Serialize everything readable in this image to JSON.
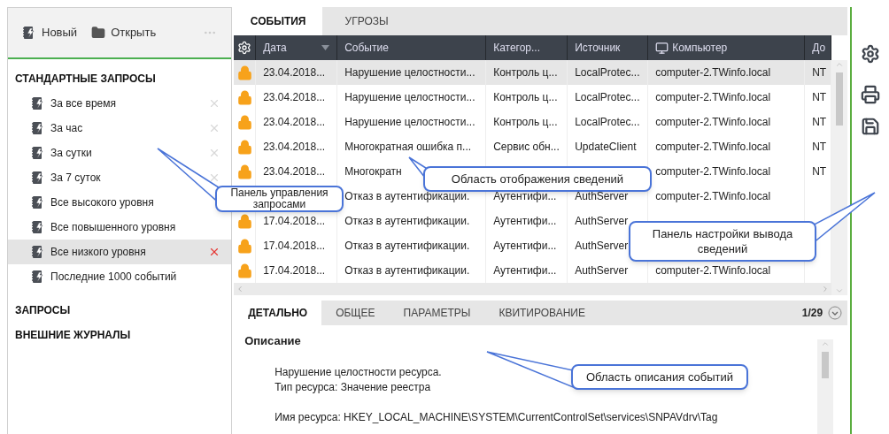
{
  "toolbar": {
    "buttons": [
      {
        "label": "Новый",
        "kind": "new"
      },
      {
        "label": "Открыть",
        "kind": "open"
      }
    ]
  },
  "sidebar": {
    "sections": [
      {
        "title": "СТАНДАРТНЫЕ ЗАПРОСЫ",
        "items": [
          {
            "label": "За все время",
            "selected": false,
            "removable": true
          },
          {
            "label": "За час",
            "selected": false,
            "removable": true
          },
          {
            "label": "За сутки",
            "selected": false,
            "removable": true
          },
          {
            "label": "За 7 суток",
            "selected": false,
            "removable": true
          },
          {
            "label": "Все высокого уровня",
            "selected": false,
            "removable": false
          },
          {
            "label": "Все повышенного уровня",
            "selected": false,
            "removable": false
          },
          {
            "label": "Все низкого уровня",
            "selected": true,
            "removable": true
          },
          {
            "label": "Последние 1000 событий",
            "selected": false,
            "removable": false
          }
        ]
      },
      {
        "title": "ЗАПРОСЫ"
      },
      {
        "title": "ВНЕШНИЕ ЖУРНАЛЫ"
      }
    ]
  },
  "tabs": [
    {
      "label": "СОБЫТИЯ",
      "selected": true
    },
    {
      "label": "УГРОЗЫ",
      "selected": false
    }
  ],
  "table": {
    "columns": [
      {
        "label": "Дата",
        "sorted": true
      },
      {
        "label": "Событие"
      },
      {
        "label": "Категор..."
      },
      {
        "label": "Источник"
      },
      {
        "label": "Компьютер",
        "icon": true
      },
      {
        "label": "До"
      }
    ],
    "rows": [
      {
        "selected": true,
        "locked": true,
        "cells": [
          "23.04.2018...",
          "Нарушение целостности...",
          "Контроль ц...",
          "LocalProtec...",
          "computer-2.TWinfo.local",
          "NT"
        ]
      },
      {
        "selected": false,
        "locked": true,
        "cells": [
          "23.04.2018...",
          "Нарушение целостности...",
          "Контроль ц...",
          "LocalProtec...",
          "computer-2.TWinfo.local",
          "NT"
        ]
      },
      {
        "selected": false,
        "locked": true,
        "cells": [
          "23.04.2018...",
          "Нарушение целостности...",
          "Контроль ц...",
          "LocalProtec...",
          "computer-2.TWinfo.local",
          "NT"
        ]
      },
      {
        "selected": false,
        "locked": true,
        "cells": [
          "23.04.2018...",
          "Многократная ошибка п...",
          "Сервис обн...",
          "UpdateClient",
          "computer-2.TWinfo.local",
          "NT"
        ]
      },
      {
        "selected": false,
        "locked": true,
        "cells": [
          "23.04.2018...",
          "Многократн",
          null,
          null,
          "computer-2.TWinfo.local",
          "NT"
        ]
      },
      {
        "selected": false,
        "cells": [
          null,
          "Отказ в аутентификации.",
          "Аутентифи...",
          "AuthServer",
          "computer-2.TWinfo.local",
          null
        ]
      },
      {
        "selected": false,
        "locked": true,
        "cells": [
          "17.04.2018...",
          "Отказ в аутентификации.",
          "Аутентифи...",
          "AuthServer",
          null,
          null
        ]
      },
      {
        "selected": false,
        "locked": true,
        "cells": [
          "17.04.2018...",
          "Отказ в аутентификации.",
          "Аутентифи...",
          "AuthServer",
          null,
          null
        ]
      },
      {
        "selected": false,
        "locked": true,
        "cells": [
          "17.04.2018...",
          "Отказ в аутентификации.",
          "Аутентифи...",
          "AuthServer",
          "computer-2.TWinfo.local",
          null
        ]
      }
    ]
  },
  "details": {
    "tabs": [
      {
        "label": "ДЕТАЛЬНО",
        "selected": true
      },
      {
        "label": "ОБЩЕЕ",
        "selected": false
      },
      {
        "label": "ПАРАМЕТРЫ",
        "selected": false
      },
      {
        "label": "КВИТИРОВАНИЕ",
        "selected": false
      }
    ],
    "counter": "1/29",
    "heading": "Описание",
    "paragraphs": [
      [
        "Нарушение целостности ресурса.",
        "Тип ресурса: Значение реестра"
      ],
      [
        "Имя ресурса: HKEY_LOCAL_MACHINE\\SYSTEM\\CurrentControlSet\\services\\SNPAVdrv\\Tag"
      ]
    ]
  },
  "callouts": [
    "Панель управления запросами",
    "Область отображения сведений",
    "Панель настройки вывода сведений",
    "Область описания событий"
  ]
}
